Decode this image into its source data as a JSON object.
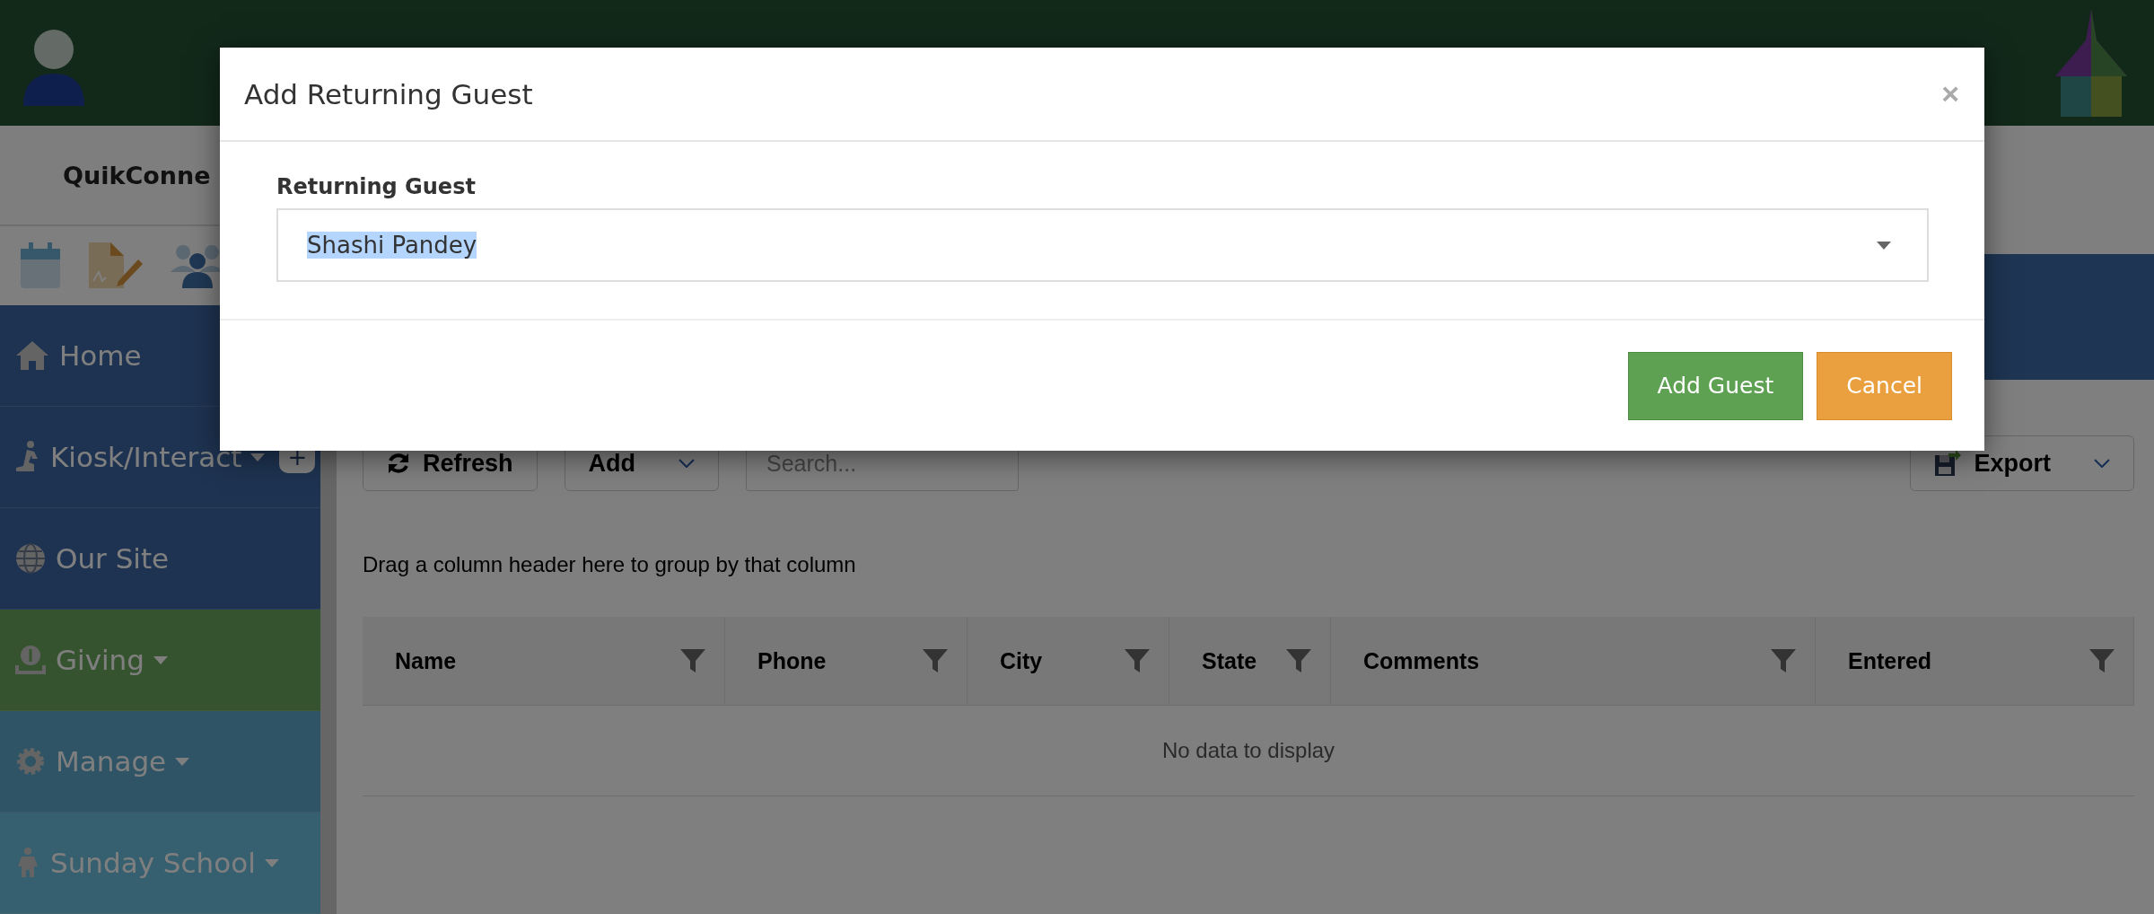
{
  "quick_connect": {
    "title": "QuikConne"
  },
  "sidebar": {
    "items": [
      {
        "label": "Home",
        "dropdown": false
      },
      {
        "label": "Kiosk/Interact",
        "dropdown": true,
        "badge": "+"
      },
      {
        "label": "Our Site",
        "dropdown": false
      },
      {
        "label": "Giving",
        "dropdown": true
      },
      {
        "label": "Manage",
        "dropdown": true
      },
      {
        "label": "Sunday School",
        "dropdown": true
      }
    ]
  },
  "toolbar": {
    "refresh": "Refresh",
    "add": "Add",
    "search_placeholder": "Search...",
    "export": "Export"
  },
  "group_hint": "Drag a column header here to group by that column",
  "grid": {
    "columns": [
      "Name",
      "Phone",
      "City",
      "State",
      "Comments",
      "Entered"
    ],
    "empty_message": "No data to display"
  },
  "dialog": {
    "title": "Add Returning Guest",
    "close": "×",
    "field_label": "Returning Guest",
    "field_value": "Shashi Pandey",
    "buttons": [
      {
        "label": "Add Guest",
        "kind": "primary"
      },
      {
        "label": "Cancel",
        "kind": "warning"
      }
    ]
  }
}
